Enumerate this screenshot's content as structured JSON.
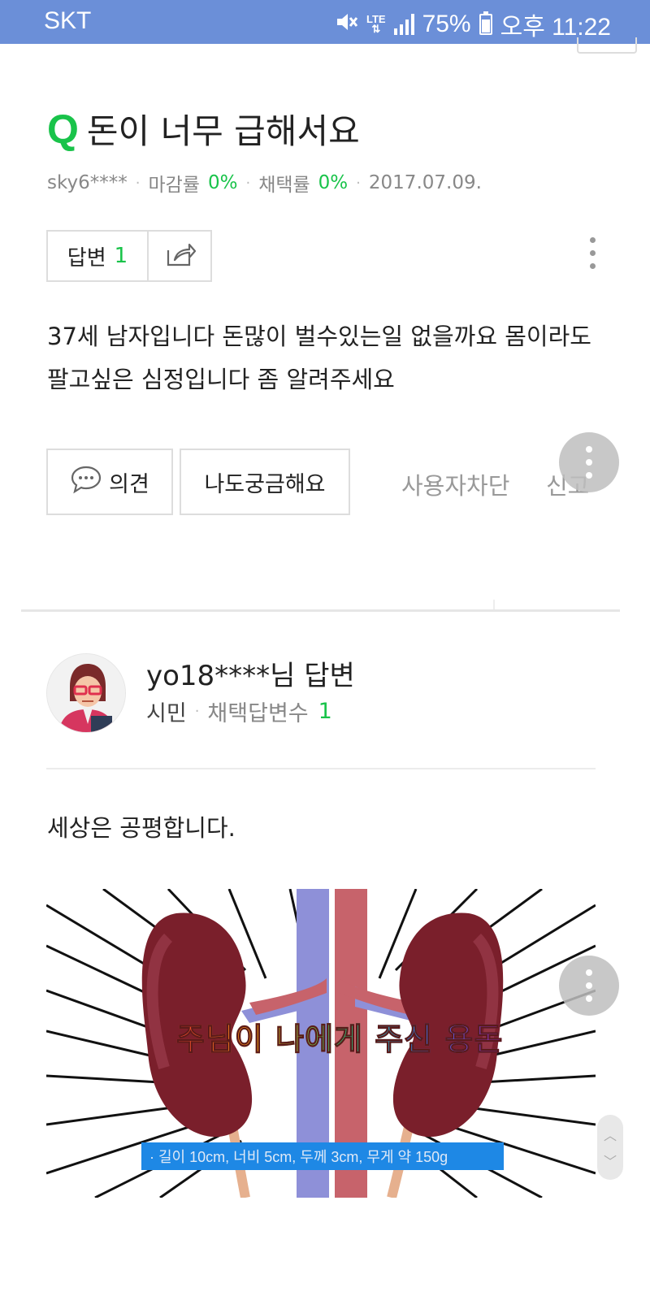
{
  "status_bar": {
    "carrier": "SKT",
    "network": "LTE",
    "battery": "75%",
    "time": "오후 11:22"
  },
  "question": {
    "q_mark": "Q",
    "title": "돈이 너무 급해서요",
    "author": "sky6****",
    "close_rate_label": "마감률",
    "close_rate_value": "0%",
    "adopt_rate_label": "채택률",
    "adopt_rate_value": "0%",
    "date": "2017.07.09.",
    "answers_label": "답변",
    "answers_count": "1",
    "body": "37세 남자입니다 돈많이 벌수있는일 없을까요 몸이라도 팔고싶은 심정입니다 좀 알려주세요"
  },
  "actions": {
    "opinion_label": "의견",
    "curious_label": "나도궁금해요",
    "block_user_label": "사용자차단",
    "report_label": "신고"
  },
  "answer": {
    "user": "yo18****님 답변",
    "level": "시민",
    "adopted_label": "채택답변수",
    "adopted_count": "1",
    "body": "세상은 공평합니다.",
    "image_overlay_text": "주님이 나에게 주신 용돈",
    "image_caption": "· 길이 10cm, 너비 5cm, 두께 3cm, 무게 약 150g"
  },
  "colors": {
    "status_bar": "#6b8fd8",
    "accent_green": "#19c34a",
    "caption_blue": "#1e88e5"
  }
}
